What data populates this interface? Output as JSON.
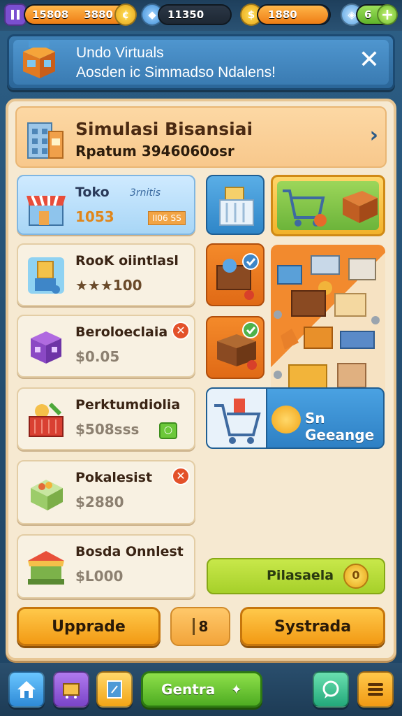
{
  "topbar": {
    "level_value": "15808",
    "coins_value": "3880",
    "gems_value": "11350",
    "gold_value": "1880",
    "count_value": "6",
    "level_icon": "pause-icon",
    "plus_label": "+"
  },
  "banner": {
    "title": "Undo Virtuals",
    "subtitle": "Aosden ic Simmadso Ndalens!",
    "close_label": "✕"
  },
  "header": {
    "title": "Simulasi Bisansiai",
    "subtitle": "Rpatum 3946060osr"
  },
  "items": [
    {
      "name": "Toko",
      "value": "1053",
      "tag": "II06 SS",
      "extra": "3rnitis"
    },
    {
      "name": "RooK oiintlasl",
      "value": "★★★100"
    },
    {
      "name": "Beroloeclaia",
      "value": "$0.05"
    },
    {
      "name": "Perktumdiolia",
      "value": "$508sss"
    },
    {
      "name": "Pokalesist",
      "value": "$2880"
    },
    {
      "name": "Bosda Onnlest",
      "value": "$L000"
    }
  ],
  "right": {
    "challenge_label": "Sn Geeange",
    "progress_label": "Pilasaela"
  },
  "actions": {
    "upgrade_label": "Upprade",
    "middle_label": "8",
    "systrada_label": "Systrada"
  },
  "nav": {
    "center_label": "Gentra"
  },
  "colors": {
    "accent_orange": "#f39a18",
    "panel_bg": "#f6e9d1",
    "blue": "#3a7bb2",
    "green": "#7ec83a"
  }
}
